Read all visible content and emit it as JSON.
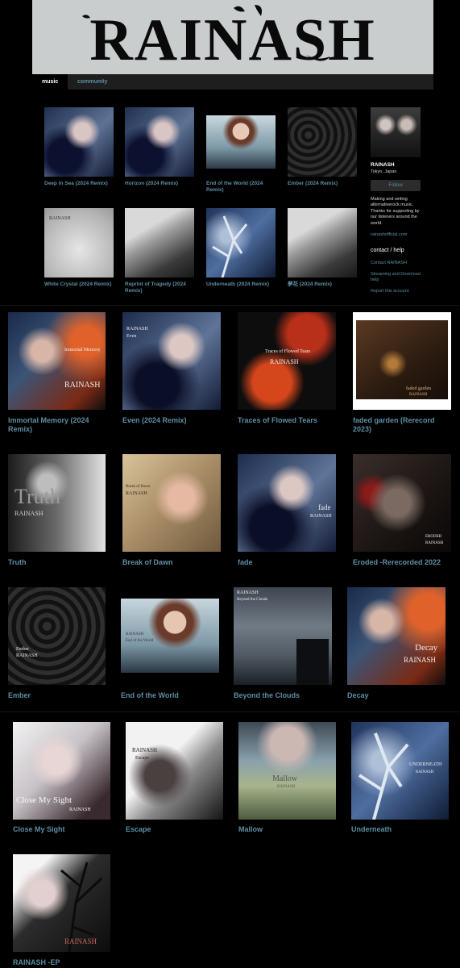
{
  "header": {
    "logo_text": "RAINASH"
  },
  "nav": {
    "tabs": [
      "music",
      "community"
    ]
  },
  "top_grid": [
    {
      "title": "Deep in Sea (2024 Remix)"
    },
    {
      "title": "Horizon (2024 Remix)"
    },
    {
      "title": "End of the World (2024 Remix)"
    },
    {
      "title": "Ember (2024 Remix)"
    },
    {
      "title": "White Crystal (2024 Remix)"
    },
    {
      "title": "Reprint of Tragedy (2024 Remix)"
    },
    {
      "title": "Underneath (2024 Remix)"
    },
    {
      "title": "夢花 (2024 Remix)"
    }
  ],
  "sidebar": {
    "name": "RAINASH",
    "location": "Tokyo, Japan",
    "follow_label": "Follow",
    "bio": "Making and writing alternativerock music. Thanks for supporting by our listeners around the world.",
    "website": "rainashofficial.com",
    "contact_heading": "contact / help",
    "contact_link": "Contact RAINASH",
    "help_link": "Streaming and Download help",
    "report_link": "Report this account"
  },
  "discography": [
    {
      "title": "Immortal Memory (2024 Remix)"
    },
    {
      "title": "Even (2024 Remix)"
    },
    {
      "title": "Traces of Flowed Tears"
    },
    {
      "title": "faded garden (Rerecord 2023)"
    },
    {
      "title": "Truth"
    },
    {
      "title": "Break of Dawn"
    },
    {
      "title": "fade"
    },
    {
      "title": "Eroded -Rerecorded 2022"
    },
    {
      "title": "Ember"
    },
    {
      "title": "End of the World"
    },
    {
      "title": "Beyond the Clouds"
    },
    {
      "title": "Decay"
    },
    {
      "title": "Close My Sight"
    },
    {
      "title": "Escape"
    },
    {
      "title": "Mallow"
    },
    {
      "title": "Underneath"
    },
    {
      "title": "RAINASH -EP"
    }
  ],
  "cover_text": {
    "artist": "RAINASH",
    "immortal": "Immortal Memory",
    "even": "Even",
    "traces": "Traces of Flowed Tears",
    "faded": "faded garden",
    "truth": "Truth",
    "break": "Break of Dawn",
    "fade": "fade",
    "eroded": "ERODED",
    "ember": "Ember",
    "eotw": "End of the World",
    "beyond": "Beyond the Clouds",
    "decay": "Decay",
    "close": "Close My Sight",
    "escape": "Escape",
    "mallow": "Mallow",
    "underneath": "UNDERNEATH"
  }
}
